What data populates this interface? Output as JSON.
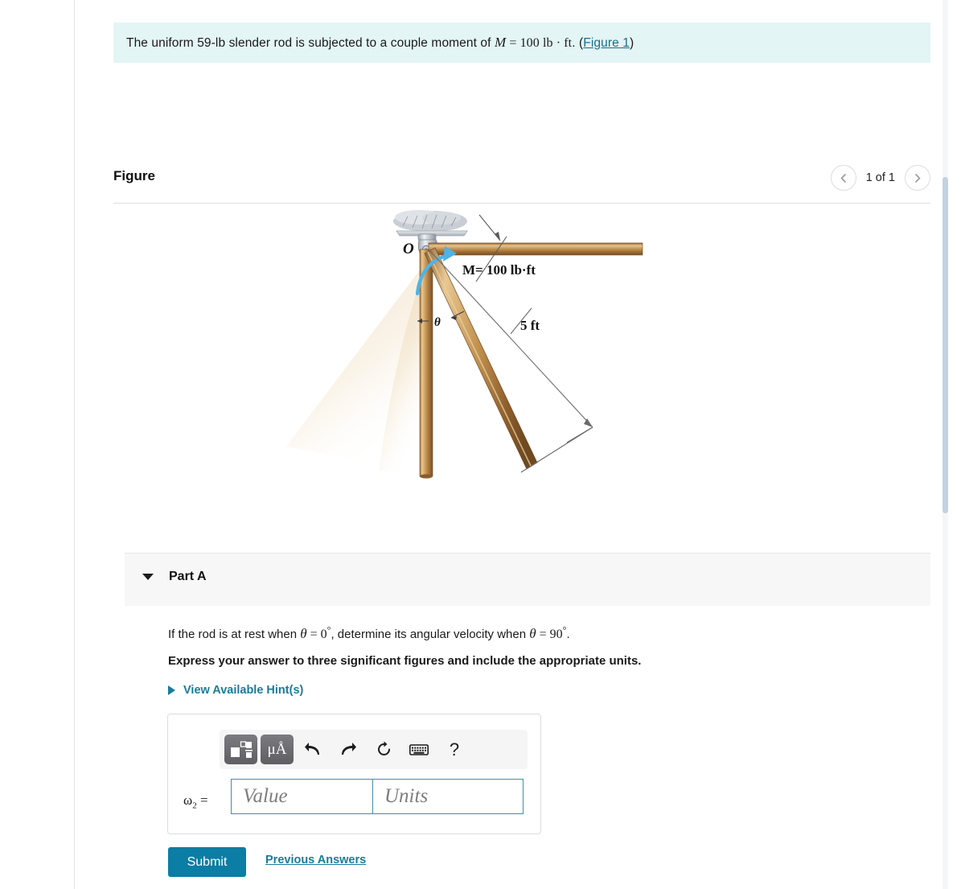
{
  "statement": {
    "part1": "The uniform 59-lb slender rod is subjected to a couple moment of ",
    "symbol_M": "M",
    "equals": " = ",
    "moment_value": "100 lb · ft",
    "period": ". (",
    "figure_link": "Figure 1",
    "close": ")"
  },
  "figure": {
    "title": "Figure",
    "nav": {
      "prev_icon": "chevron-left-icon",
      "count": "1 of 1",
      "next_icon": "chevron-right-icon"
    },
    "labels": {
      "pivot": "O",
      "moment": "M= 100 lb·ft",
      "length": "5 ft",
      "angle": "θ"
    }
  },
  "part_a": {
    "label": "Part A",
    "caret_icon": "caret-down-icon",
    "question_pre": "If the rod is at rest when ",
    "theta": "θ",
    "eq0": " = 0",
    "deg": "°",
    "question_mid": ", determine its angular velocity when ",
    "eq90": " = 90",
    "question_end": ".",
    "instruction": "Express your answer to three significant figures and include the appropriate units.",
    "hints_label": "View Available Hint(s)",
    "hints_caret_icon": "caret-right-icon"
  },
  "answer": {
    "variable": "ω",
    "subscript": "2",
    "equals": "=",
    "value_placeholder": "Value",
    "units_placeholder": "Units",
    "toolbar": [
      {
        "name": "math-template-icon",
        "label": ""
      },
      {
        "name": "units-icon",
        "label": "μÅ"
      },
      {
        "name": "undo-icon",
        "label": ""
      },
      {
        "name": "redo-icon",
        "label": ""
      },
      {
        "name": "reset-icon",
        "label": ""
      },
      {
        "name": "keyboard-icon",
        "label": ""
      },
      {
        "name": "help-icon",
        "label": "?"
      }
    ]
  },
  "footer": {
    "submit_label": "Submit",
    "previous_answers_label": "Previous Answers"
  },
  "colors": {
    "statement_bg": "#e3f5f4",
    "accent_link": "#1a7b9b",
    "submit_bg": "#0c7da4",
    "field_border": "#3e90ad",
    "parta_bg": "#f7f7f7"
  }
}
